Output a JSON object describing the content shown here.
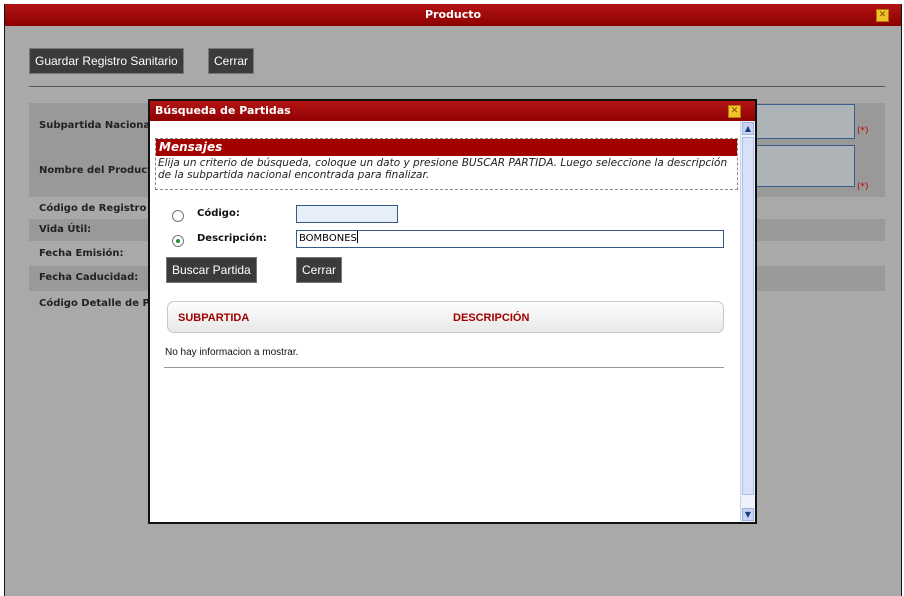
{
  "window": {
    "title": "Producto"
  },
  "toolbar": {
    "save_label": "Guardar Registro Sanitario",
    "close_label": "Cerrar"
  },
  "form": {
    "fields": [
      {
        "label": "Subpartida Nacional:"
      },
      {
        "label": "Nombre del Producto"
      },
      {
        "label": "Código de Registro S"
      },
      {
        "label": "Vida Útil:"
      },
      {
        "label": "Fecha Emisión:"
      },
      {
        "label": "Fecha Caducidad:"
      },
      {
        "label": "Código Detalle de Par"
      }
    ],
    "required_mark": "(*)"
  },
  "dialog": {
    "title": "Búsqueda de Partidas",
    "messages": {
      "header": "Mensajes",
      "text": "Elija un criterio de búsqueda, coloque un dato y presione BUSCAR PARTIDA. Luego seleccione la descripción de la subpartida nacional encontrada para finalizar."
    },
    "criteria": {
      "codigo_label": "Código:",
      "codigo_value": "",
      "descripcion_label": "Descripción:",
      "descripcion_value": "BOMBONES",
      "selected": "descripcion"
    },
    "buttons": {
      "search": "Buscar Partida",
      "close": "Cerrar"
    },
    "table": {
      "columns": [
        "SUBPARTIDA",
        "DESCRIPCIÓN"
      ],
      "empty_text": "No hay informacion a mostrar."
    }
  },
  "icons": {
    "close": "close-icon",
    "scroll_up": "chevron-up-icon",
    "scroll_down": "chevron-down-icon"
  },
  "colors": {
    "title_bar": "#a00000",
    "required": "#c00000",
    "button_bg": "#3b3b3b",
    "header_text": "#a00000"
  }
}
